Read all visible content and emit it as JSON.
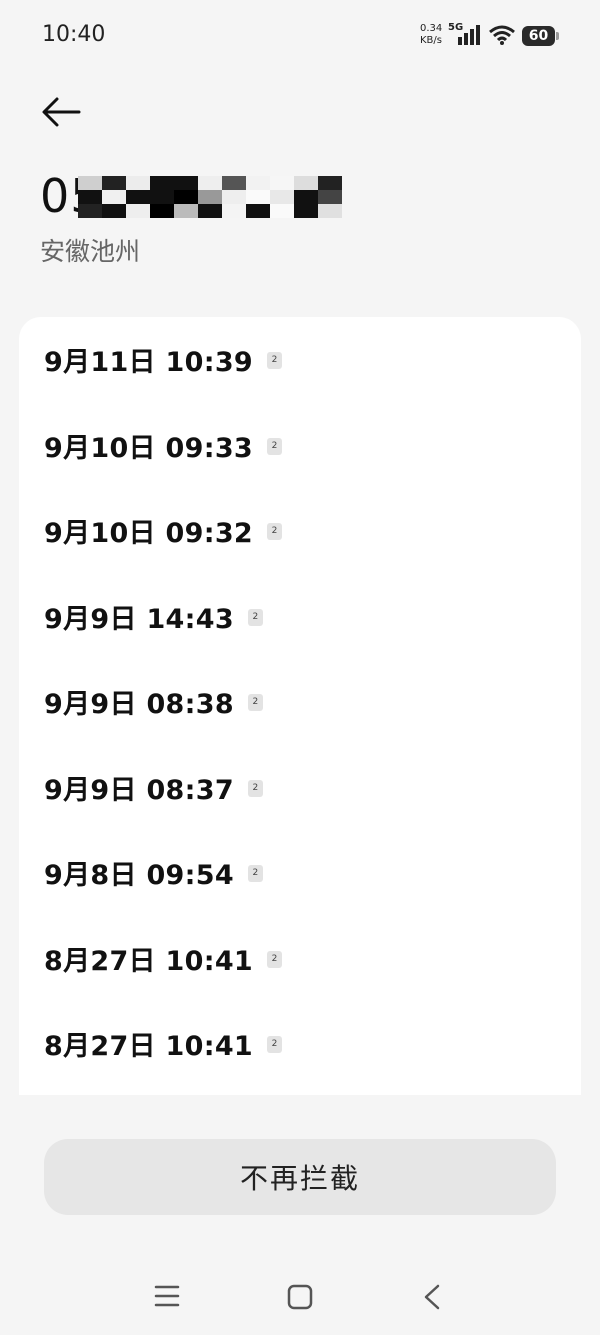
{
  "status_bar": {
    "time": "10:40",
    "net_speed_value": "0.34",
    "net_speed_unit": "KB/s",
    "network_type": "5G",
    "battery_level": "60"
  },
  "header": {
    "phone_number_visible": "056",
    "location": "安徽池州"
  },
  "call_records": [
    {
      "time": "9月11日 10:39",
      "sim": "2"
    },
    {
      "time": "9月10日 09:33",
      "sim": "2"
    },
    {
      "time": "9月10日 09:32",
      "sim": "2"
    },
    {
      "time": "9月9日 14:43",
      "sim": "2"
    },
    {
      "time": "9月9日 08:38",
      "sim": "2"
    },
    {
      "time": "9月9日 08:37",
      "sim": "2"
    },
    {
      "time": "9月8日 09:54",
      "sim": "2"
    },
    {
      "time": "8月27日 10:41",
      "sim": "2"
    },
    {
      "time": "8月27日 10:41",
      "sim": "2"
    }
  ],
  "actions": {
    "unblock_label": "不再拦截"
  },
  "icons": {
    "back": "arrow-left-icon",
    "signal": "signal-bars-icon",
    "wifi": "wifi-icon",
    "battery": "battery-icon",
    "nav_menu": "menu-icon",
    "nav_home": "home-square-icon",
    "nav_back": "chevron-left-icon"
  }
}
